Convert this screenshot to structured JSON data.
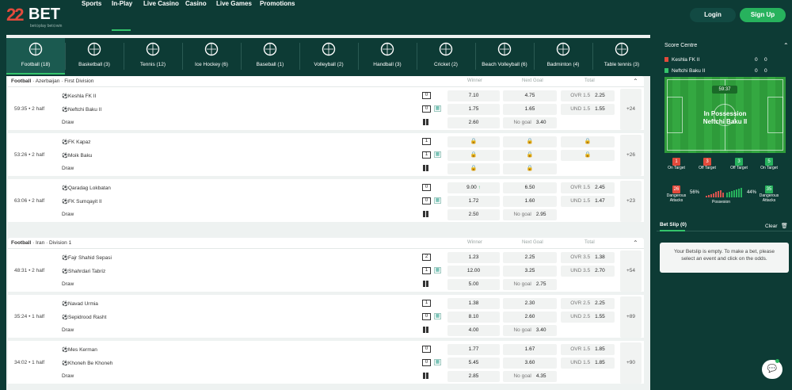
{
  "brand": {
    "mark": "22",
    "word": "BET",
    "tagline": "bet⊙play  bet⊙win",
    "accent": "#34c46b",
    "primary_bg": "#0d3b35"
  },
  "nav": [
    {
      "label": "Sports"
    },
    {
      "label": "In-Play",
      "active": true
    },
    {
      "label": "Live Casino"
    },
    {
      "label": "Casino"
    },
    {
      "label": "Live Games"
    },
    {
      "label": "Promotions"
    }
  ],
  "auth": {
    "login": "Login",
    "signup": "Sign Up"
  },
  "sports": [
    {
      "label": "Football (18)",
      "icon": "football-icon",
      "active": true
    },
    {
      "label": "Basketball (3)",
      "icon": "basketball-icon"
    },
    {
      "label": "Tennis (12)",
      "icon": "tennis-icon"
    },
    {
      "label": "Ice Hockey (6)",
      "icon": "ice-hockey-icon"
    },
    {
      "label": "Baseball (1)",
      "icon": "baseball-icon"
    },
    {
      "label": "Volleyball (2)",
      "icon": "volleyball-icon"
    },
    {
      "label": "Handball (3)",
      "icon": "handball-icon"
    },
    {
      "label": "Cricket (2)",
      "icon": "cricket-icon"
    },
    {
      "label": "Beach Volleyball (6)",
      "icon": "beach-volleyball-icon"
    },
    {
      "label": "Badminton (4)",
      "icon": "badminton-icon"
    },
    {
      "label": "Table tennis (3)",
      "icon": "table-tennis-icon"
    }
  ],
  "columns": {
    "winner": "Winner",
    "next_goal": "Next Goal",
    "total": "Total"
  },
  "leagues": [
    {
      "sport": "Football",
      "path": " · Azerbaijan · First Division",
      "matches": [
        {
          "time": "59:35 • 2 half",
          "home": "Keshla FK II",
          "away": "Neftchi Baku II",
          "score_home": "0",
          "score_away": "0",
          "draw": "Draw",
          "w1": "7.10",
          "w2": "1.75",
          "wx": "2.60",
          "ng1": "4.75",
          "ng2": "1.65",
          "ngx_label": "No goal",
          "ngx": "3.40",
          "t1_label": "OVR 1.5",
          "t1": "2.25",
          "t2_label": "UND 1.5",
          "t2": "1.55",
          "more": "+24"
        },
        {
          "time": "53:26 • 2 half",
          "home": "FK Kapaz",
          "away": "Moik Baku",
          "score_home": "1",
          "score_away": "1",
          "draw": "Draw",
          "locked": true,
          "more": "+26"
        },
        {
          "time": "63:06 • 2 half",
          "home": "Qaradag Lokbatan",
          "away": "FK Sumqayit II",
          "score_home": "0",
          "score_away": "0",
          "draw": "Draw",
          "w1": "9.00",
          "w2": "1.72",
          "wx": "2.50",
          "ng1": "6.50",
          "ng2": "1.60",
          "ngx_label": "No goal",
          "ngx": "2.95",
          "t1_label": "OVR 1.5",
          "t1": "2.45",
          "t2_label": "UND 1.5",
          "t2": "1.47",
          "more": "+23"
        }
      ]
    },
    {
      "sport": "Football",
      "path": " · Iran · Division 1",
      "matches": [
        {
          "time": "48:31 • 2 half",
          "home": "Fajr Shahid Sepasi",
          "away": "Shahrdari Tabriz",
          "score_home": "2",
          "score_away": "1",
          "draw": "Draw",
          "w1": "1.23",
          "w2": "12.00",
          "wx": "5.00",
          "ng1": "2.25",
          "ng2": "3.25",
          "ngx_label": "No goal",
          "ngx": "2.75",
          "t1_label": "OVR 3.5",
          "t1": "1.38",
          "t2_label": "UND 3.5",
          "t2": "2.70",
          "more": "+54"
        },
        {
          "time": "35:24 • 1 half",
          "home": "Navad Urmia",
          "away": "Sepidrood Rasht",
          "score_home": "1",
          "score_away": "0",
          "draw": "Draw",
          "w1": "1.38",
          "w2": "8.10",
          "wx": "4.00",
          "ng1": "2.30",
          "ng2": "2.60",
          "ngx_label": "No goal",
          "ngx": "3.40",
          "t1_label": "OVR 2.5",
          "t1": "2.25",
          "t2_label": "UND 2.5",
          "t2": "1.55",
          "more": "+89"
        },
        {
          "time": "34:02 • 1 half",
          "home": "Mes Kerman",
          "away": "Khoneh Be Khoneh",
          "score_home": "0",
          "score_away": "0",
          "draw": "Draw",
          "w1": "1.77",
          "w2": "5.45",
          "wx": "2.85",
          "ng1": "1.67",
          "ng2": "3.60",
          "ngx_label": "No goal",
          "ngx": "4.35",
          "t1_label": "OVR 1.5",
          "t1": "1.85",
          "t2_label": "UND 1.5",
          "t2": "1.85",
          "more": "+90"
        }
      ]
    }
  ],
  "score_centre": {
    "title": "Score Centre",
    "home": "Keshla FK II",
    "away": "Neftchi Baku II",
    "home_a": "0",
    "home_b": "0",
    "away_a": "0",
    "away_b": "0",
    "clock": "59:37",
    "possession_line1": "In Possession",
    "possession_line2": "Neftchi Baku II",
    "on_target_home": "1",
    "off_target_home": "3",
    "off_target_away": "3",
    "on_target_away": "5",
    "on_target_label": "On Target",
    "off_target_label": "Off Target",
    "dang_home": "26",
    "dang_away": "35",
    "dang_label": "Dangerous Attacks",
    "poss_home": "56%",
    "poss_away": "44%",
    "poss_label": "Possesion"
  },
  "betslip": {
    "title": "Bet Slip (0)",
    "clear": "Clear",
    "empty": "Your Betslip is empty. To make a bet, please select an event and click on the odds."
  }
}
